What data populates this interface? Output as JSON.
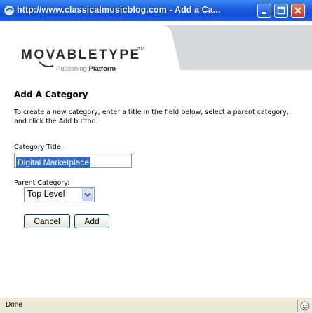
{
  "window": {
    "title": "http://www.classicalmusicblog.com - Add a Ca..."
  },
  "header": {
    "logo_main": "MOVABLETYPE",
    "logo_tm": "TM",
    "logo_sub_light": "Publishing",
    "logo_sub_bold": "Platform"
  },
  "form": {
    "heading": "Add A Category",
    "description": "To create a new category, enter a title in the field below, select a parent category, and click the Add button.",
    "title_label": "Category Title:",
    "title_value": "Digital Marketplace",
    "parent_label": "Parent Category:",
    "parent_selected": "Top Level",
    "cancel_label": "Cancel",
    "add_label": "Add"
  },
  "status": {
    "text": "Done"
  },
  "colors": {
    "titlebar": "#1f62e0",
    "header_band": "#d5d8da",
    "selection": "#316ac5"
  }
}
